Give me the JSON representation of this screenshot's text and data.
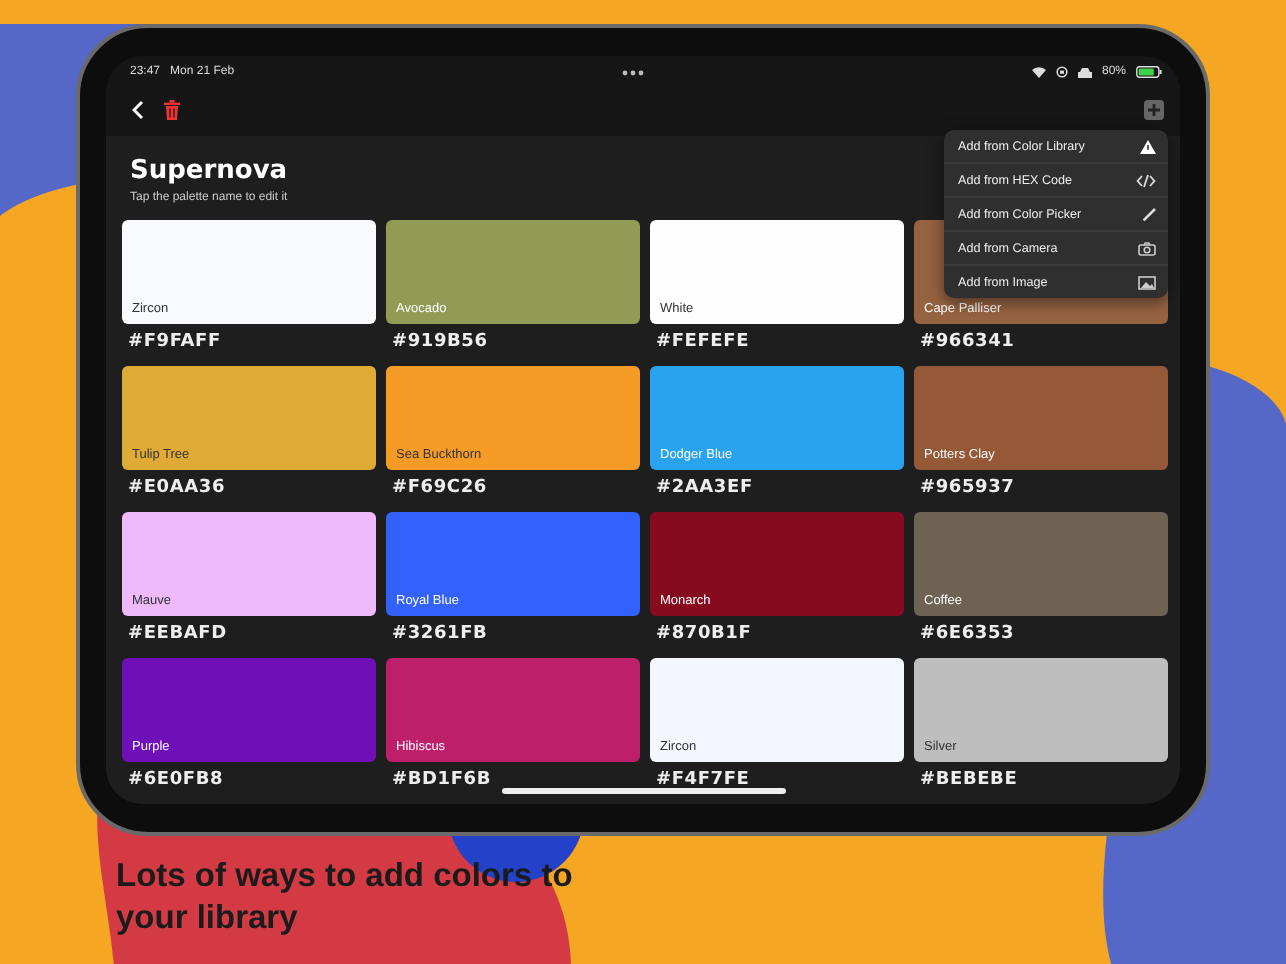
{
  "status_bar": {
    "time": "23:47",
    "date": "Mon 21 Feb",
    "battery": "80%"
  },
  "palette": {
    "title": "Supernova",
    "hint": "Tap the palette name to edit it"
  },
  "swatches": [
    {
      "name": "Zircon",
      "hex": "#F9FAFF",
      "color": "#f9faff"
    },
    {
      "name": "Avocado",
      "hex": "#919B56",
      "color": "#919b56"
    },
    {
      "name": "White",
      "hex": "#FEFEFE",
      "color": "#fefefe"
    },
    {
      "name": "Cape Palliser",
      "hex": "#966341",
      "color": "#966341"
    },
    {
      "name": "Tulip Tree",
      "hex": "#E0AA36",
      "color": "#e0aa36"
    },
    {
      "name": "Sea Buckthorn",
      "hex": "#F69C26",
      "color": "#f69c26"
    },
    {
      "name": "Dodger Blue",
      "hex": "#2AA3EF",
      "color": "#2aa3ef"
    },
    {
      "name": "Potters Clay",
      "hex": "#965937",
      "color": "#965937"
    },
    {
      "name": "Mauve",
      "hex": "#EEBAFD",
      "color": "#eebafd"
    },
    {
      "name": "Royal Blue",
      "hex": "#3261FB",
      "color": "#3261fb"
    },
    {
      "name": "Monarch",
      "hex": "#870B1F",
      "color": "#870b1f"
    },
    {
      "name": "Coffee",
      "hex": "#6E6353",
      "color": "#6e6353"
    },
    {
      "name": "Purple",
      "hex": "#6E0FB8",
      "color": "#6e0fb8"
    },
    {
      "name": "Hibiscus",
      "hex": "#BD1F6B",
      "color": "#bd1f6b"
    },
    {
      "name": "Zircon",
      "hex": "#F4F7FE",
      "color": "#f4f7fe"
    },
    {
      "name": "Silver",
      "hex": "#BEBEBE",
      "color": "#bebebe"
    }
  ],
  "add_menu": [
    {
      "label": "Add from Color Library",
      "kind": "library"
    },
    {
      "label": "Add from HEX Code",
      "kind": "code"
    },
    {
      "label": "Add from Color Picker",
      "kind": "picker"
    },
    {
      "label": "Add from Camera",
      "kind": "camera"
    },
    {
      "label": "Add from Image",
      "kind": "image"
    }
  ],
  "caption": "Lots of ways to add colors to your library"
}
